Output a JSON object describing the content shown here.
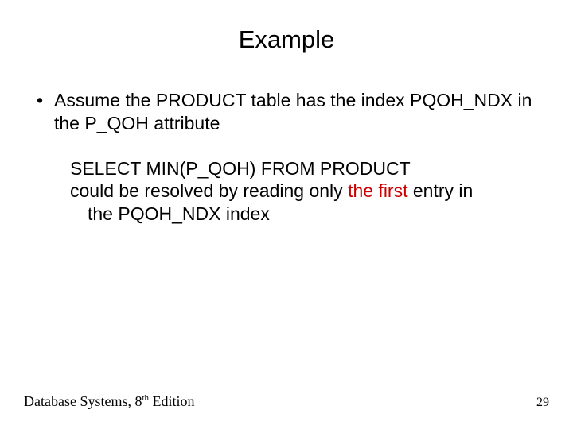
{
  "title": "Example",
  "bullet": {
    "marker": "•",
    "text": "Assume the PRODUCT table has the index PQOH_NDX in the P_QOH attribute"
  },
  "sub": {
    "line1": "SELECT MIN(P_QOH) FROM PRODUCT",
    "line2_a": "could be resolved by reading only ",
    "line2_hl": "the first",
    "line2_b": " entry in",
    "line2_cont": "the PQOH_NDX index"
  },
  "footer": {
    "book_a": "Database Systems, 8",
    "book_sup": "th",
    "book_b": " Edition",
    "page": "29"
  }
}
